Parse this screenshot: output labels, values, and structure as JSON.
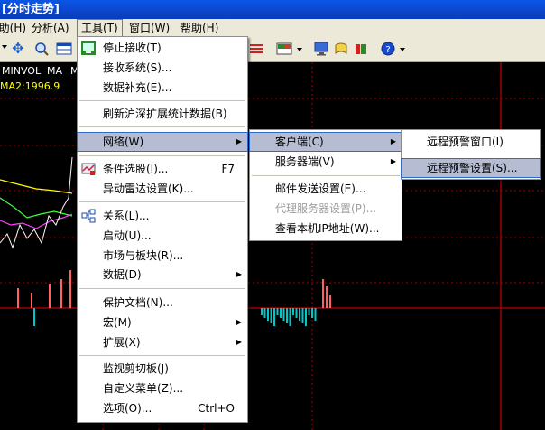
{
  "window": {
    "title": "[分时走势]"
  },
  "menubar": {
    "items": [
      {
        "label": "]助(H)"
      },
      {
        "label": "分析(A)"
      },
      {
        "label": "工具(T)"
      },
      {
        "label": "窗口(W)"
      },
      {
        "label": "帮助(H)"
      }
    ]
  },
  "chart": {
    "indicators": [
      "MINVOL",
      "MA",
      "M"
    ],
    "ma2_label": "MA2:1996.9",
    "colors": {
      "background": "#000000",
      "grid": "#a00000",
      "up": "#ff6060",
      "down": "#00c8c8",
      "line_white": "#ffffff",
      "line_yellow": "#ffff00",
      "line_magenta": "#ff40ff",
      "line_green": "#40ff40"
    }
  },
  "tools_menu": {
    "items": [
      {
        "label": "停止接收(T)",
        "shortcut": ""
      },
      {
        "label": "接收系统(S)...",
        "shortcut": ""
      },
      {
        "label": "数据补充(E)...",
        "shortcut": ""
      },
      {
        "label": "刷新沪深扩展统计数据(B)",
        "shortcut": ""
      },
      {
        "label": "网络(W)",
        "shortcut": ""
      },
      {
        "label": "条件选股(I)...",
        "shortcut": "F7"
      },
      {
        "label": "异动雷达设置(K)...",
        "shortcut": ""
      },
      {
        "label": "关系(L)...",
        "shortcut": ""
      },
      {
        "label": "启动(U)...",
        "shortcut": ""
      },
      {
        "label": "市场与板块(R)...",
        "shortcut": ""
      },
      {
        "label": "数据(D)",
        "shortcut": ""
      },
      {
        "label": "保护文档(N)...",
        "shortcut": ""
      },
      {
        "label": "宏(M)",
        "shortcut": ""
      },
      {
        "label": "扩展(X)",
        "shortcut": ""
      },
      {
        "label": "监视剪切板(J)",
        "shortcut": ""
      },
      {
        "label": "自定义菜单(Z)...",
        "shortcut": ""
      },
      {
        "label": "选项(O)...",
        "shortcut": "Ctrl+O"
      }
    ]
  },
  "network_menu": {
    "items": [
      {
        "label": "客户端(C)"
      },
      {
        "label": "服务器端(V)"
      },
      {
        "label": "邮件发送设置(E)..."
      },
      {
        "label": "代理服务器设置(P)..."
      },
      {
        "label": "查看本机IP地址(W)..."
      }
    ]
  },
  "client_menu": {
    "items": [
      {
        "label": "远程预警窗口(I)"
      },
      {
        "label": "远程预警设置(S)..."
      }
    ]
  }
}
